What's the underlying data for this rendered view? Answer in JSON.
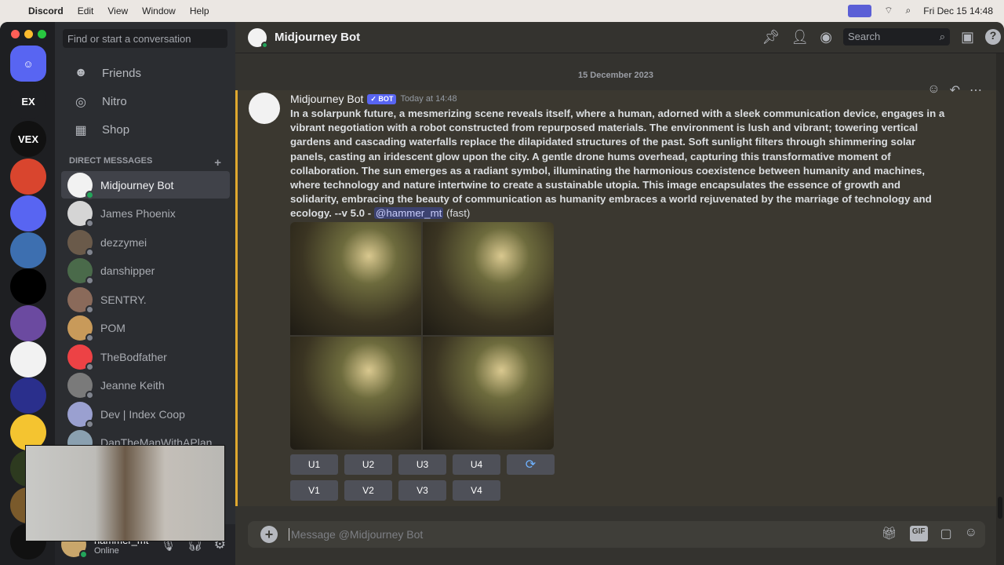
{
  "menubar": {
    "app": "Discord",
    "items": [
      "Edit",
      "View",
      "Window",
      "Help"
    ],
    "clock": "Fri Dec 15  14:48"
  },
  "sidebar": {
    "search_placeholder": "Find or start a conversation",
    "nav": [
      {
        "label": "Friends",
        "icon": "friends-icon"
      },
      {
        "label": "Nitro",
        "icon": "nitro-icon"
      },
      {
        "label": "Shop",
        "icon": "shop-icon"
      }
    ],
    "dm_header": "DIRECT MESSAGES",
    "dm_add": "+",
    "dms": [
      "Midjourney Bot",
      "James Phoenix",
      "dezzymei",
      "danshipper",
      "SENTRY.",
      "POM",
      "TheBodfather",
      "Jeanne Keith",
      "Dev | Index Coop",
      "DanTheManWithAPlan"
    ],
    "user": {
      "name": "hammer_mt",
      "status": "Online"
    }
  },
  "servers": [
    {
      "label": "EX",
      "color": "#1e1f22"
    },
    {
      "label": "VEX",
      "color": "#111"
    },
    {
      "label": "",
      "color": "#d9452e"
    },
    {
      "label": "",
      "color": "#5865f2"
    },
    {
      "label": "",
      "color": "#3d6fb0"
    },
    {
      "label": "",
      "color": "#000"
    },
    {
      "label": "",
      "color": "#6b4aa0"
    },
    {
      "label": "",
      "color": "#f2f2f2"
    },
    {
      "label": "",
      "color": "#2a2f8c"
    },
    {
      "label": "",
      "color": "#f4c430"
    },
    {
      "label": "",
      "color": "#2d3a1f"
    },
    {
      "label": "",
      "color": "#7a5a2b"
    },
    {
      "label": "",
      "color": "#111"
    }
  ],
  "header": {
    "title": "Midjourney Bot",
    "search_placeholder": "Search"
  },
  "chat": {
    "date": "15 December 2023",
    "message": {
      "author": "Midjourney Bot",
      "badge": "✓ BOT",
      "timestamp": "Today at 14:48",
      "text": "In a solarpunk future, a mesmerizing scene reveals itself, where a human, adorned with a sleek communication device, engages in a vibrant negotiation with a robot constructed from repurposed materials. The environment is lush and vibrant; towering vertical gardens and cascading waterfalls replace the dilapidated structures of the past. Soft sunlight filters through shimmering solar panels, casting an iridescent glow upon the city. A gentle drone hums overhead, capturing this transformative moment of collaboration. The sun emerges as a radiant symbol, illuminating the harmonious coexistence between humanity and machines, where technology and nature intertwine to create a sustainable utopia. This image encapsulates the essence of growth and solidarity, embracing the beauty of communication as humanity embraces a world rejuvenated by the marriage of technology and ecology. --v 5.0 - ",
      "mention": "@hammer_mt",
      "suffix": " (fast)",
      "upscale_buttons": [
        "U1",
        "U2",
        "U3",
        "U4"
      ],
      "variation_buttons": [
        "V1",
        "V2",
        "V3",
        "V4"
      ],
      "reroll_icon": "refresh-icon"
    }
  },
  "composer": {
    "placeholder": "Message @Midjourney Bot"
  },
  "colors": {
    "accent": "#5865f2",
    "online": "#23a55a",
    "highlight": "#e0a82e"
  }
}
